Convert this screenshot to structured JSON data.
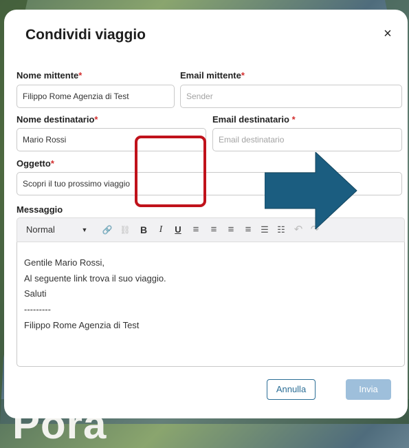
{
  "background": {
    "visible_text": "Pora"
  },
  "dialog": {
    "title": "Condividi viaggio",
    "close_symbol": "×"
  },
  "form": {
    "sender_name": {
      "label": "Nome mittente",
      "required_mark": "*",
      "value": "Filippo Rome Agenzia di Test"
    },
    "sender_email": {
      "label": "Email mittente",
      "required_mark": "*",
      "placeholder": "Sender"
    },
    "recipient_name": {
      "label": "Nome destinatario",
      "required_mark": "*",
      "value": "Mario Rossi"
    },
    "recipient_email": {
      "label": "Email destinatario ",
      "required_mark": "*",
      "placeholder": "Email destinatario"
    },
    "subject": {
      "label": "Oggetto",
      "required_mark": "*",
      "value": "Scopri il tuo prossimo viaggio"
    },
    "message": {
      "label": "Messaggio",
      "toolbar": {
        "format": "Normal",
        "caret": "▼",
        "link": "🔗",
        "unlink": "⛓",
        "bold": "B",
        "italic": "I",
        "underline": "U",
        "align_left": "≡",
        "align_center": "≡",
        "align_right": "≡",
        "justify": "≡",
        "bullet_list": "☰",
        "numbered_list": "☷",
        "undo": "↶",
        "redo": "↷"
      },
      "lines": [
        "Gentile Mario Rossi,",
        "Al seguente link trova il suo viaggio.",
        "Saluti",
        "---------",
        "Filippo Rome Agenzia di Test"
      ]
    }
  },
  "buttons": {
    "cancel": "Annulla",
    "send": "Invia"
  },
  "colors": {
    "required": "#d32f2f",
    "primary": "#2b6e96",
    "primary_disabled": "#9ebfdb",
    "highlight": "#c0121b",
    "arrow": "#1b5d80"
  }
}
